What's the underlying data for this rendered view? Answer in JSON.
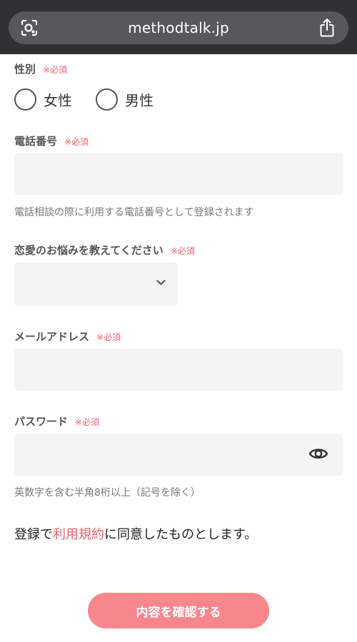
{
  "browser": {
    "url": "methodtalk.jp",
    "lens_icon": "lens-icon",
    "share_icon": "share-icon"
  },
  "required_mark": "※必須",
  "gender": {
    "label": "性別",
    "options": [
      "女性",
      "男性"
    ]
  },
  "phone": {
    "label": "電話番号",
    "value": "",
    "hint": "電話相談の際に利用する電話番号として登録されます"
  },
  "concern": {
    "label": "恋愛のお悩みを教えてください",
    "selected": "",
    "icon": "chevron-down-icon"
  },
  "email": {
    "label": "メールアドレス",
    "value": ""
  },
  "password": {
    "label": "パスワード",
    "value": "",
    "hint": "英数字を含む半角8桁以上（記号を除く）",
    "icon": "eye-icon"
  },
  "agreement": {
    "prefix": "登録で",
    "link": "利用規約",
    "suffix": "に同意したものとします。"
  },
  "confirm_button": "内容を確認する",
  "colors": {
    "accent": "#e8636b",
    "button": "#f7878d",
    "field_bg": "#f4f4f4",
    "topbar": "#2f3235"
  }
}
